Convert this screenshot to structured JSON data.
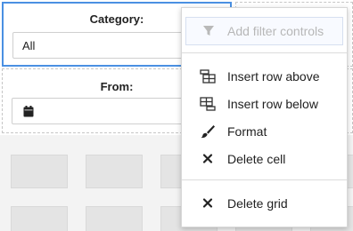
{
  "filters": {
    "category": {
      "title": "Category:",
      "value": "All"
    },
    "from": {
      "title": "From:",
      "icon": "calendar-icon"
    }
  },
  "context_menu": {
    "items": [
      {
        "label": "Add filter controls",
        "icon": "filter-icon",
        "enabled": false
      },
      {
        "label": "Insert row above",
        "icon": "insert-row-above-icon",
        "enabled": true
      },
      {
        "label": "Insert row below",
        "icon": "insert-row-below-icon",
        "enabled": true
      },
      {
        "label": "Format",
        "icon": "paintbrush-icon",
        "enabled": true
      },
      {
        "label": "Delete cell",
        "icon": "close-icon",
        "enabled": true
      },
      {
        "label": "Delete grid",
        "icon": "close-icon",
        "enabled": true
      }
    ]
  },
  "colors": {
    "selection_border": "#4a90e2",
    "menu_text": "#212121",
    "disabled_text": "#b7b7b7"
  }
}
